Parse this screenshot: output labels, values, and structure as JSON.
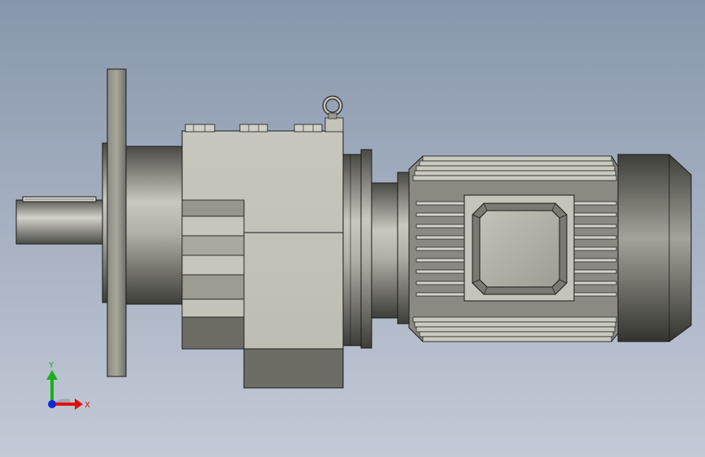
{
  "viewport": {
    "model": "gear-motor-assembly",
    "colors": {
      "background_top": "#8897ac",
      "background_bottom": "#c4cad6",
      "steel_light": "#c9c9c0",
      "steel_mid": "#8f8f86",
      "steel_dark": "#4f4f49",
      "outline": "#1a1a1a"
    }
  },
  "triad": {
    "x_label": "X",
    "y_label": "Y",
    "x_color": "#e01010",
    "y_color": "#18b018",
    "z_color": "#1028e0"
  }
}
